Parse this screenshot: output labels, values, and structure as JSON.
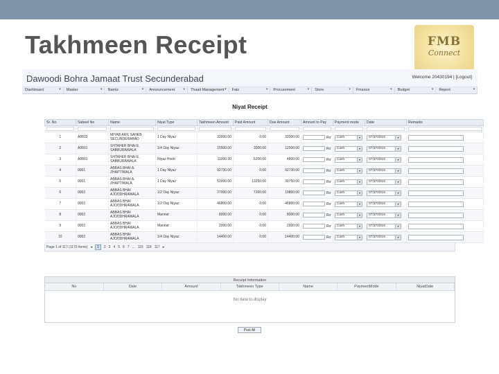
{
  "slide": {
    "title": "Takhmeen Receipt"
  },
  "logo": {
    "line1": "FMB",
    "line2": "Connect"
  },
  "app": {
    "title": "Dawoodi Bohra Jamaat Trust Secunderabad",
    "welcome": "Welcome 20430194 | [Logout]"
  },
  "menu": [
    "Dashboard",
    "Master",
    "Namiz",
    "Announcement",
    "Thaali Management",
    "Faiz",
    "Procurement",
    "Store",
    "Finance",
    "Budget",
    "Report"
  ],
  "grid": {
    "title": "Niyat Receipt",
    "columns": [
      "Sr. No.",
      "Sabeel No",
      "Name",
      "Niyat Type",
      "Takhmeen Amount",
      "Paid Amount",
      "Due Amount",
      "Amount to Pay",
      "Payment mode",
      "Date",
      "Remarks"
    ],
    "rows": [
      {
        "sr": "1",
        "sabeel": "A0033",
        "name": "MIYAB ARIL SAHEB SECUNDERABAD",
        "type": "1 Day Niyaz",
        "takhmeen": "33000.00",
        "paid": "0.00",
        "due": "33000.00",
        "mode": "Cash",
        "date": "07/27/2015"
      },
      {
        "sr": "2",
        "sabeel": "A0001",
        "name": "SHTAHER BHAI E. SABBURAWALA",
        "type": "1/4 Day Niyaz",
        "takhmeen": "15500.00",
        "paid": "3000.00",
        "due": "12500.00",
        "mode": "Cash",
        "date": "07/27/2015"
      },
      {
        "sr": "3",
        "sabeel": "A0001",
        "name": "SHTAHER BHAI E. SABBURAWALA",
        "type": "Niyaz Hoob",
        "takhmeen": "11000.00",
        "paid": "6200.00",
        "due": "4800.00",
        "mode": "Cash",
        "date": "07/27/2015"
      },
      {
        "sr": "4",
        "sabeel": "0001",
        "name": "ABBAS BHAI A. ZHAPTIWALA",
        "type": "1 Day Niyaz",
        "takhmeen": "92730.00",
        "paid": "0.00",
        "due": "92730.00",
        "mode": "Cash",
        "date": "07/27/2015"
      },
      {
        "sr": "5",
        "sabeel": "0001",
        "name": "ABBAS BHAI A. ZHAPTIWALA",
        "type": "1 Day Niyaz",
        "takhmeen": "53000.00",
        "paid": "13250.00",
        "due": "39750.00",
        "mode": "Cash",
        "date": "07/27/2015"
      },
      {
        "sr": "6",
        "sabeel": "0002",
        "name": "ABBAS BHAI AJOODHRAWALA",
        "type": "1/2 Day Niyaz",
        "takhmeen": "27000.00",
        "paid": "7200.00",
        "due": "19800.00",
        "mode": "Cash",
        "date": "07/27/2015"
      },
      {
        "sr": "7",
        "sabeel": "0002",
        "name": "ABBAS BHAI AJOODHRAWALA",
        "type": "1/2 Day Niyaz",
        "takhmeen": "46800.00",
        "paid": "0.00",
        "due": "46800.00",
        "mode": "Cash",
        "date": "07/27/2015"
      },
      {
        "sr": "8",
        "sabeel": "0002",
        "name": "ABBAS BHAI AJOODHRAWALA",
        "type": "Mannat",
        "takhmeen": "8000.00",
        "paid": "0.00",
        "due": "8000.00",
        "mode": "Cash",
        "date": "07/27/2015"
      },
      {
        "sr": "9",
        "sabeel": "0002",
        "name": "ABBAS BHAI AJOODHRAWALA",
        "type": "Mannat",
        "takhmeen": "2000.00",
        "paid": "0.00",
        "due": "2000.00",
        "mode": "Cash",
        "date": "07/27/2015"
      },
      {
        "sr": "10",
        "sabeel": "0002",
        "name": "ABBAS BHAI AJOODHRAWALA",
        "type": "1/4 Day Niyaz",
        "takhmeen": "14400.00",
        "paid": "0.00",
        "due": "14400.00",
        "mode": "Cash",
        "date": "07/27/2015"
      }
    ],
    "rupee": "Rs",
    "pager": {
      "info": "Page 1 of 117 (1170 items)",
      "pages": [
        "1",
        "2",
        "3",
        "4",
        "5",
        "6",
        "7",
        "...",
        "115",
        "116",
        "117"
      ],
      "current": "1"
    }
  },
  "receipt": {
    "title": "Receipt Information",
    "columns": [
      "No",
      "Date",
      "Amount",
      "Takhmeen Type",
      "Name",
      "PaymentMode",
      "NiyatDate"
    ],
    "empty": "No data to display"
  },
  "post_button": "Post All"
}
